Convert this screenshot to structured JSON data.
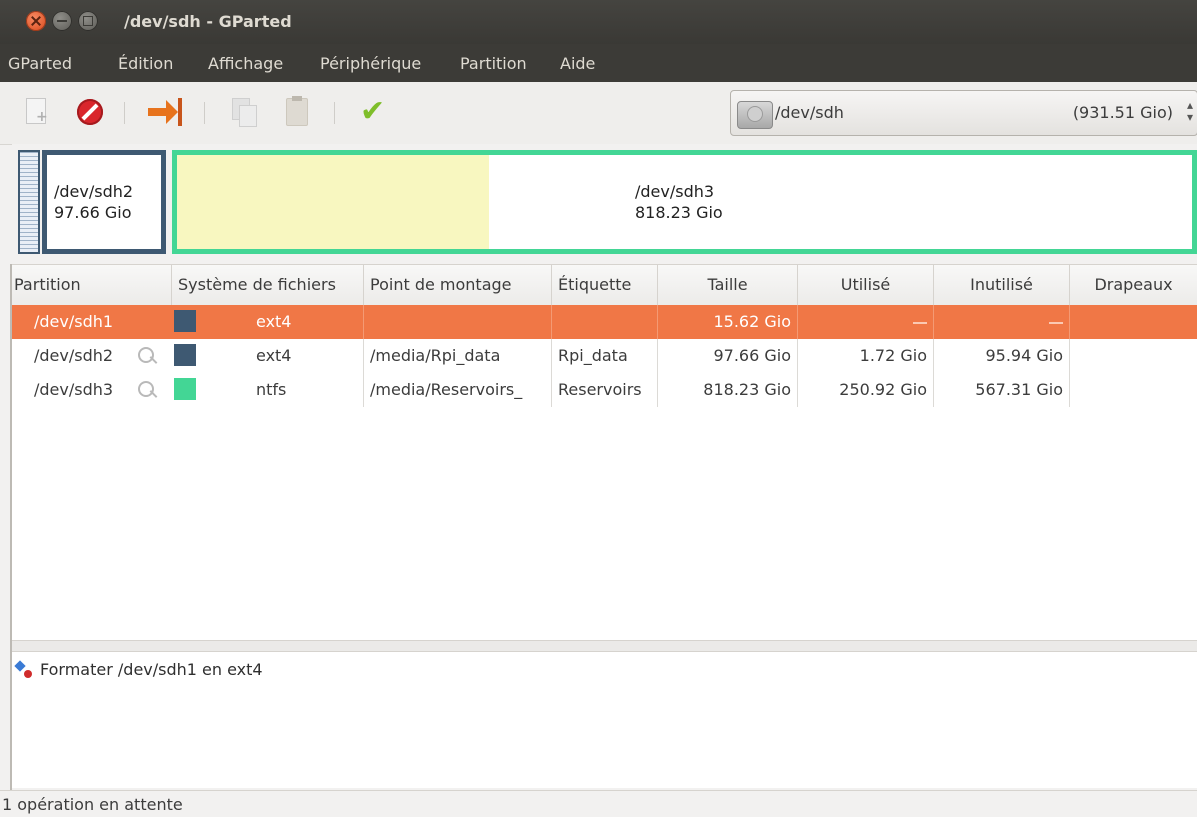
{
  "window": {
    "title": "/dev/sdh - GParted"
  },
  "menubar": {
    "items": [
      {
        "label": "GParted"
      },
      {
        "label": "Édition"
      },
      {
        "label": "Affichage"
      },
      {
        "label": "Périphérique"
      },
      {
        "label": "Partition"
      },
      {
        "label": "Aide"
      }
    ]
  },
  "toolbar": {
    "buttons": [
      {
        "icon": "new-partition-icon",
        "enabled": false
      },
      {
        "icon": "delete-icon",
        "enabled": true
      },
      {
        "icon": "resize-move-icon",
        "enabled": true
      },
      {
        "icon": "copy-icon",
        "enabled": false
      },
      {
        "icon": "paste-icon",
        "enabled": false
      },
      {
        "icon": "apply-check-icon",
        "enabled": true
      }
    ],
    "device": {
      "name": "/dev/sdh",
      "size": "(931.51 Gio)"
    }
  },
  "diskmap": {
    "partitions": [
      {
        "name": "/dev/sdh1",
        "label_visible": false,
        "color": "#3e5972"
      },
      {
        "name": "/dev/sdh2",
        "size": "97.66 Gio",
        "color": "#3e5972"
      },
      {
        "name": "/dev/sdh3",
        "size": "818.23 Gio",
        "color": "#43d695",
        "used_fraction": 0.307
      }
    ]
  },
  "table": {
    "headers": [
      "Partition",
      "Système de fichiers",
      "Point de montage",
      "Étiquette",
      "Taille",
      "Utilisé",
      "Inutilisé",
      "Drapeaux"
    ],
    "rows": [
      {
        "partition": "/dev/sdh1",
        "mounted": false,
        "fs": "ext4",
        "fs_color": "#3e5972",
        "mount": "",
        "label": "",
        "size": "15.62 Gio",
        "used": "---",
        "unused": "---",
        "flags": "",
        "selected": true
      },
      {
        "partition": "/dev/sdh2",
        "mounted": true,
        "fs": "ext4",
        "fs_color": "#3e5972",
        "mount": "/media/Rpi_data",
        "label": "Rpi_data",
        "size": "97.66 Gio",
        "used": "1.72 Gio",
        "unused": "95.94 Gio",
        "flags": "",
        "selected": false
      },
      {
        "partition": "/dev/sdh3",
        "mounted": true,
        "fs": "ntfs",
        "fs_color": "#43d695",
        "mount": "/media/Reservoirs_",
        "label": "Reservoirs",
        "size": "818.23 Gio",
        "used": "250.92 Gio",
        "unused": "567.31 Gio",
        "flags": "",
        "selected": false
      }
    ]
  },
  "operations": [
    {
      "icon": "format-operation-icon",
      "text": "Formater /dev/sdh1 en ext4"
    }
  ],
  "statusbar": {
    "text": "1 opération en attente"
  }
}
